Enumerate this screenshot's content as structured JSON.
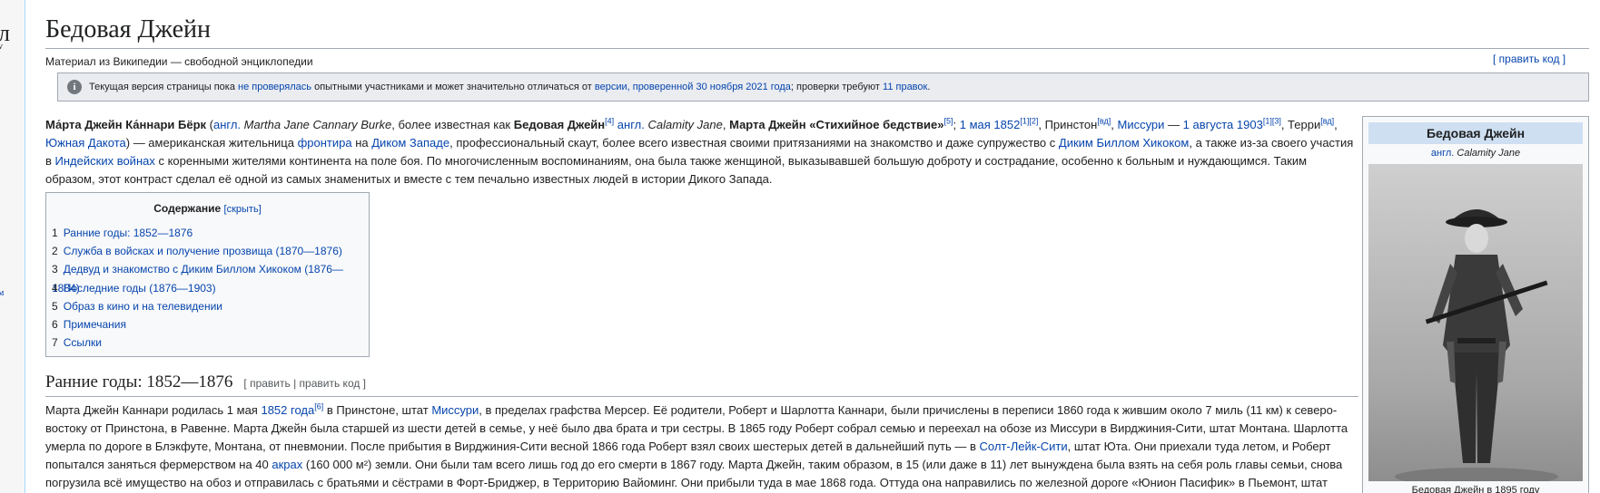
{
  "left_strip": {
    "frag1": "л",
    "frag2": "v",
    "frag3": "м"
  },
  "page": {
    "title": "Бедовая Джейн",
    "subtitle": "Материал из Википедии — свободной энциклопедии",
    "edit_code_link": "[ править код ]"
  },
  "notice": {
    "icon": "info-icon",
    "t1": "Текущая версия страницы пока ",
    "link1": "не проверялась",
    "t2": " опытными участниками и может значительно отличаться от ",
    "link2": "версии, проверенной 30 ноября 2021 года",
    "t3": "; проверки требуют ",
    "link3": "11 правок",
    "t4": "."
  },
  "lead": {
    "name_bold": "Ма́рта Джейн Ка́ннари Бёрк",
    "p1": " (",
    "lang1": "англ.",
    "name_en": " Martha Jane Cannary Burke",
    "p2": ", более известная как ",
    "alias1": "Бедовая Джейн",
    "ref4": "[4]",
    "lang2": " англ.",
    "alias_en": " Calamity Jane",
    "p3": ", ",
    "alias2": "Марта Джейн «Стихийное бедствие»",
    "ref5": "[5]",
    "p4": "; ",
    "birth_date": "1 мая 1852",
    "ref1a": "[1][2]",
    "p5": ", Принстон",
    "vd1": "[вд]",
    "p6": ", ",
    "missouri": "Миссури",
    "p7": " — ",
    "death_date": "1 августа 1903",
    "ref1b": "[1][3]",
    "p8": ", Терри",
    "vd2": "[вд]",
    "p9": ", ",
    "south_dakota": "Южная Дакота",
    "p10": ") — американская жительница ",
    "frontier": "фронтира",
    "p11": " на ",
    "wild_west": "Диком Западе",
    "p12": ", профессиональный скаут, более всего известная своими притязаниями на знакомство и даже супружество с ",
    "hickok": "Диким Биллом Хикоком",
    "p13": ", а также из-за своего участия в ",
    "indian_wars": "Индейских войнах",
    "p14": " с коренными жителями континента на поле боя. По многочисленным воспоминаниям, она была также женщиной, выказывавшей большую доброту и сострадание, особенно к больным и нуждающимся. Таким образом, этот контраст сделал её одной из самых знаменитых и вместе с тем печально известных людей в истории Дикого Запада."
  },
  "toc": {
    "title": "Содержание",
    "hide": "[скрыть]",
    "items": [
      {
        "num": "1",
        "label": "Ранние годы: 1852—1876"
      },
      {
        "num": "2",
        "label": "Служба в войсках и получение прозвища (1870—1876)"
      },
      {
        "num": "3",
        "label": "Дедвуд и знакомство с Диким Биллом Хикоком (1876—1884)"
      },
      {
        "num": "4",
        "label": "Последние годы (1876—1903)"
      },
      {
        "num": "5",
        "label": "Образ в кино и на телевидении"
      },
      {
        "num": "6",
        "label": "Примечания"
      },
      {
        "num": "7",
        "label": "Ссылки"
      }
    ]
  },
  "section1": {
    "heading": "Ранние годы: 1852—1876",
    "edit": "[ править | править код ]",
    "b1": "Марта Джейн Каннари родилась 1 мая ",
    "year_link": "1852 года",
    "ref6": "[6]",
    "b2": " в Принстоне, штат ",
    "missouri": "Миссури",
    "b3": ", в пределах графства Мерсер. Её родители, Роберт и Шарлотта Каннари, были причислены в переписи 1860 года к жившим около 7 миль (11 км) к северо-востоку от Принстона, в Равенне. Марта Джейн была старшей из шести детей в семье, у неё было два брата и три сестры. В 1865 году Роберт собрал семью и переехал на обозе из Миссури в Вирджиния-Сити, штат Монтана. Шарлотта умерла по дороге в Блэкфуте, Монтана, от пневмонии. После прибытия в Вирджиния-Сити весной 1866 года Роберт взял своих шестерых детей в дальнейший путь — в ",
    "slc": "Солт-Лейк-Сити",
    "b4": ", штат Юта. Они приехали туда летом, и Роберт попытался заняться фермерством на 40 ",
    "acres": "акрах",
    "b5": " (160 000 м²) земли. Они были там всего лишь год до его смерти в 1867 году. Марта Джейн, таким образом, в 15 (или даже в 11) лет вынуждена была взять на себя роль главы семьи, снова погрузила всё имущество на обоз и отправилась с братьями и сёстрами в Форт-Бриджер, в Территорию Вайоминг. Они прибыли туда в мае 1868 года. Оттуда она направились по железной дороге «Юнион Пасифик» в Пьемонт, штат Вайоминг."
  },
  "infobox": {
    "title": "Бедовая Джейн",
    "lang": "англ.",
    "name_en": " Calamity Jane",
    "caption": "Бедовая Джейн в 1895 году"
  }
}
